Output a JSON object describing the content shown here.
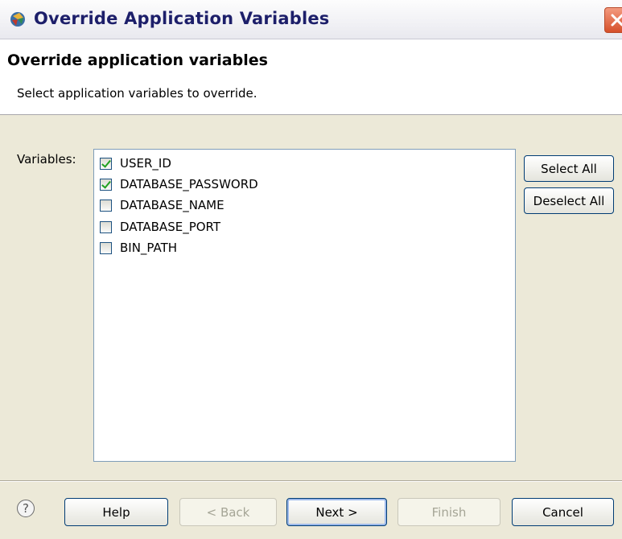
{
  "window": {
    "title": "Override Application Variables",
    "close_icon": "close-icon"
  },
  "header": {
    "title": "Override application variables",
    "description": "Select application variables to override."
  },
  "variables": {
    "label": "Variables:",
    "items": [
      {
        "label": "USER_ID",
        "checked": true
      },
      {
        "label": "DATABASE_PASSWORD",
        "checked": true
      },
      {
        "label": "DATABASE_NAME",
        "checked": false
      },
      {
        "label": "DATABASE_PORT",
        "checked": false
      },
      {
        "label": "BIN_PATH",
        "checked": false
      }
    ],
    "select_all_label": "Select All",
    "deselect_all_label": "Deselect All"
  },
  "footer": {
    "help_icon": "?",
    "help_label": "Help",
    "back_label": "< Back",
    "next_label": "Next >",
    "finish_label": "Finish",
    "cancel_label": "Cancel"
  },
  "colors": {
    "checkmark": "#21a121",
    "title_text": "#1d1f6a",
    "close_button": "#d6502a"
  }
}
